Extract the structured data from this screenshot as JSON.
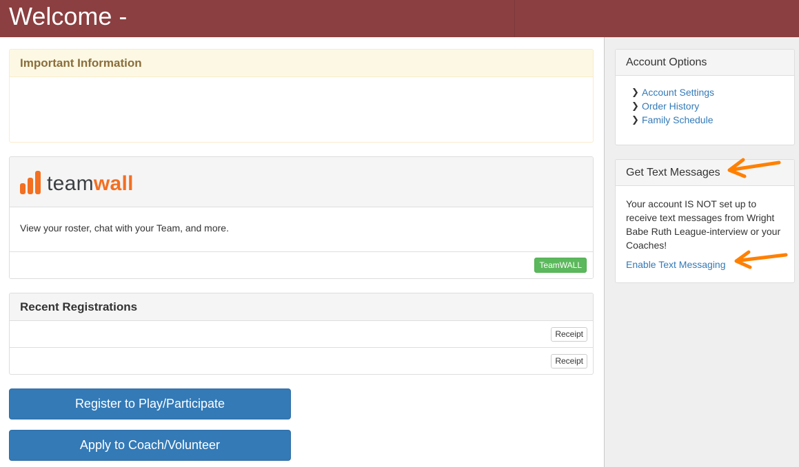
{
  "header": {
    "title": "Welcome -"
  },
  "important": {
    "title": "Important Information"
  },
  "teamwall": {
    "logo_team": "team",
    "logo_wall": "wall",
    "description": "View your roster, chat with your Team, and more.",
    "button_label": "TeamWALL",
    "brand_color": "#f36f21"
  },
  "recent": {
    "title": "Recent Registrations",
    "rows": [
      {
        "receipt_label": "Receipt"
      },
      {
        "receipt_label": "Receipt"
      }
    ]
  },
  "actions": {
    "register_label": "Register to Play/Participate",
    "apply_label": "Apply to Coach/Volunteer"
  },
  "account_options": {
    "title": "Account Options",
    "items": [
      {
        "label": "Account Settings",
        "icon": "chevron-right-icon"
      },
      {
        "label": "Order History",
        "icon": "chevron-right-icon"
      },
      {
        "label": "Family Schedule",
        "icon": "chevron-right-icon"
      }
    ]
  },
  "text_messages": {
    "title": "Get Text Messages",
    "body": "Your account IS NOT set up to receive text messages from Wright Babe Ruth League-interview or your Coaches!",
    "link_label": "Enable Text Messaging"
  },
  "colors": {
    "header_bg": "#8b3f40",
    "primary": "#337ab7",
    "success": "#5cb85c",
    "annotation_arrow": "#ff8000"
  }
}
